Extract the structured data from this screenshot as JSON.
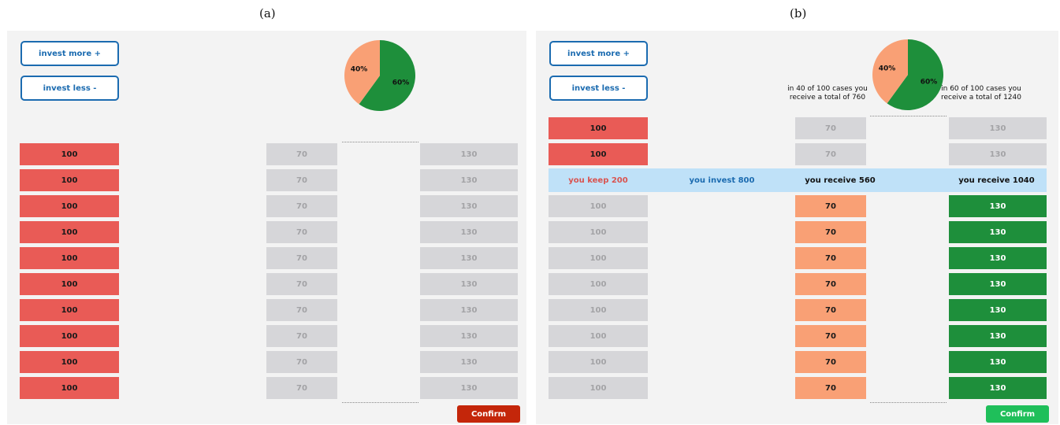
{
  "captions": {
    "a": "(a)",
    "b": "(b)"
  },
  "buttons": {
    "invest_more": "invest more +",
    "invest_less": "invest less -",
    "confirm": "Confirm"
  },
  "pie": {
    "slices": [
      {
        "label": "40%",
        "value": 40,
        "color": "#f9a075"
      },
      {
        "label": "60%",
        "value": 60,
        "color": "#1e8f3b"
      }
    ]
  },
  "values": {
    "keep": "100",
    "low": "70",
    "high": "130"
  },
  "panel_b": {
    "summary": {
      "keep": "you keep 200",
      "invest": "you invest 800",
      "receive_low": "you receive 560",
      "receive_high": "you receive 1040"
    },
    "info_low": "in 40 of 100 cases you receive a total of 760",
    "info_high": "in 60 of 100 cases you receive a total of 1240"
  },
  "colors": {
    "keep_red": "#e95b56",
    "low_orange": "#f9a075",
    "high_green": "#1e8f3b",
    "grey": "#d6d6d9",
    "confirm_a": "#c4260a",
    "confirm_b": "#1fbf5a",
    "accent_blue": "#1b6bb0",
    "summary_bg": "#bfe1f8"
  }
}
